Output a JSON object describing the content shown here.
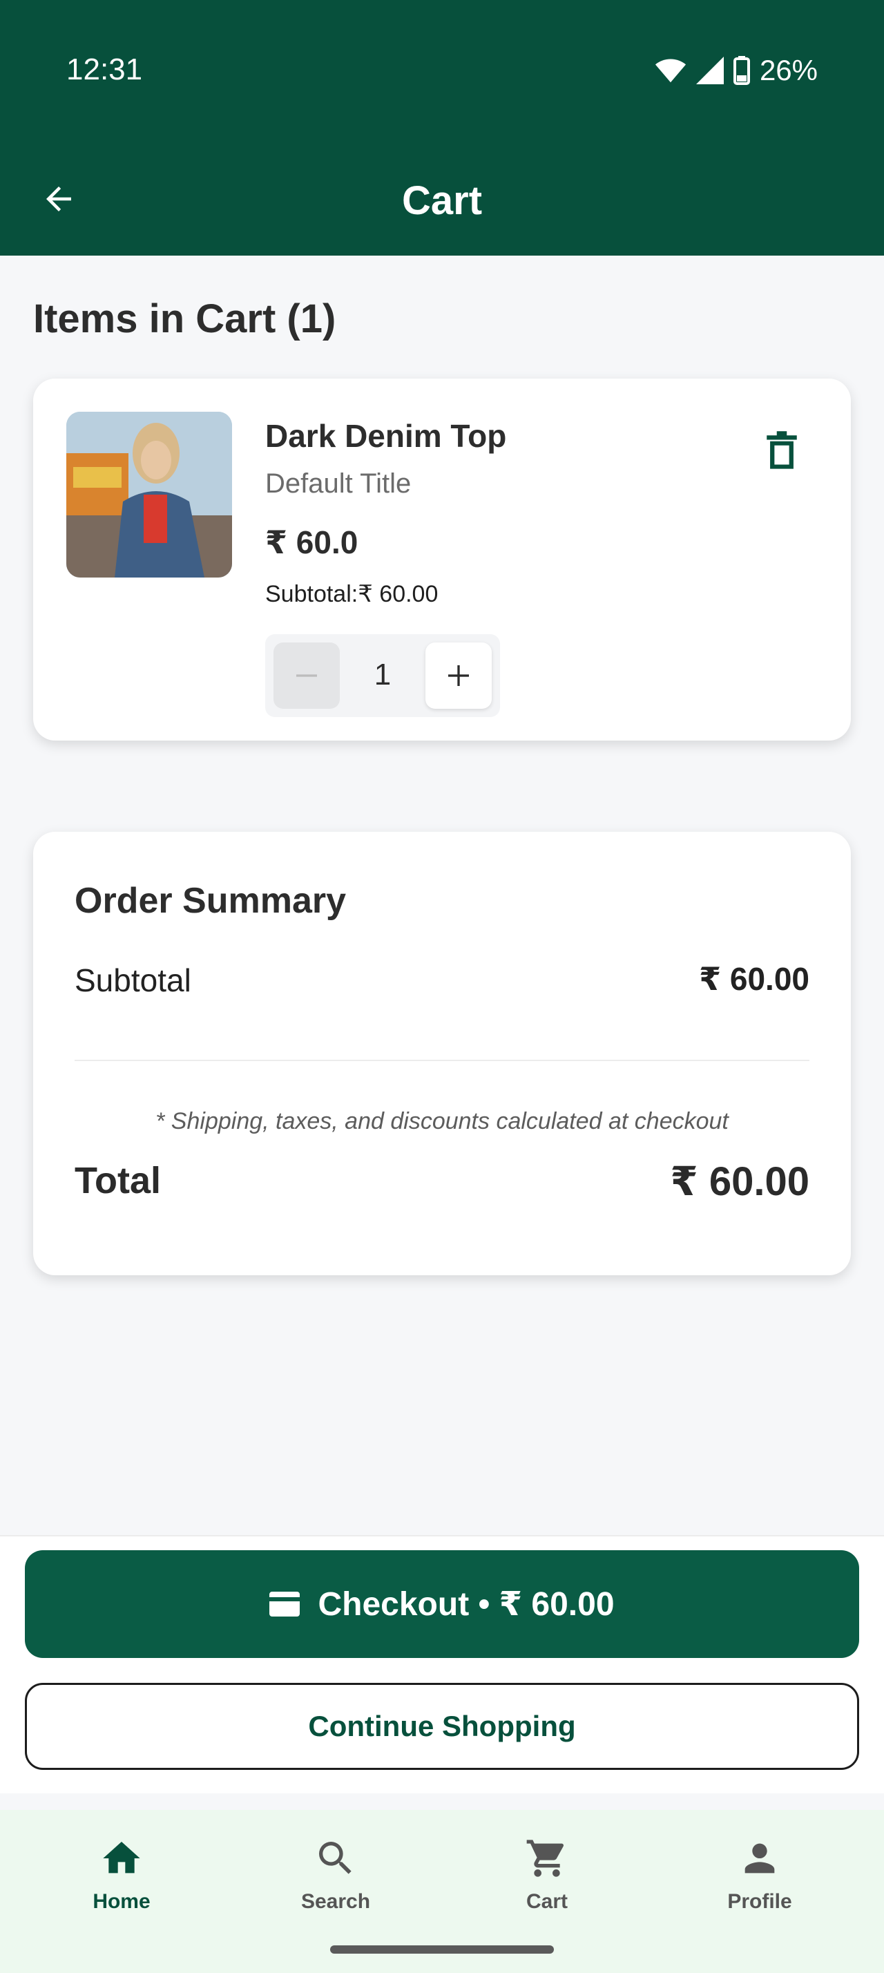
{
  "status_bar": {
    "time": "12:31",
    "battery": "26%"
  },
  "appbar": {
    "title": "Cart",
    "back_icon": "arrow-back-icon"
  },
  "cart": {
    "heading": "Items in Cart (1)",
    "items": [
      {
        "name": "Dark Denim Top",
        "variant": "Default Title",
        "price": "₹ 60.0",
        "subtotal": "Subtotal:₹ 60.00",
        "quantity": "1"
      }
    ]
  },
  "summary": {
    "title": "Order Summary",
    "subtotal_label": "Subtotal",
    "subtotal_value": "₹ 60.00",
    "note": "* Shipping, taxes, and discounts calculated at checkout",
    "total_label": "Total",
    "total_value": "₹ 60.00"
  },
  "actions": {
    "checkout_label": "Checkout • ₹ 60.00",
    "continue_label": "Continue Shopping"
  },
  "nav": {
    "items": [
      {
        "label": "Home",
        "icon": "home-icon",
        "active": true
      },
      {
        "label": "Search",
        "icon": "search-icon",
        "active": false
      },
      {
        "label": "Cart",
        "icon": "cart-icon",
        "active": false
      },
      {
        "label": "Profile",
        "icon": "profile-icon",
        "active": false
      }
    ]
  },
  "colors": {
    "brand": "#07503c",
    "button": "#0a5c45",
    "nav_background": "#edf9ef"
  }
}
